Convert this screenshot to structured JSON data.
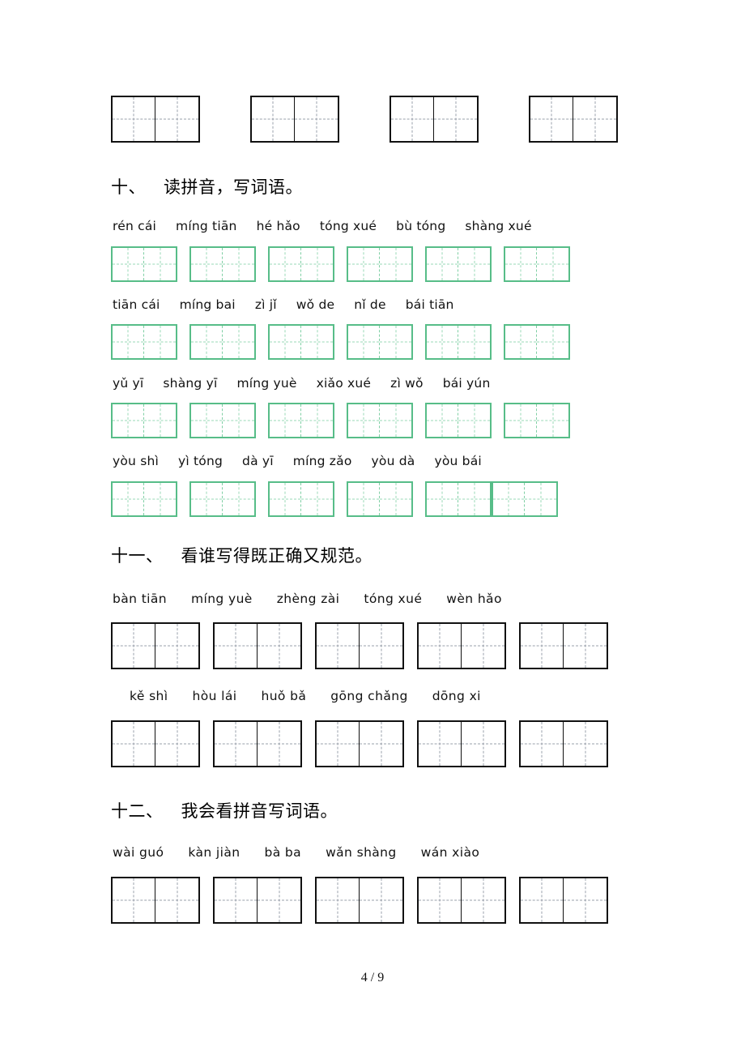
{
  "page": {
    "footer": "4 / 9",
    "colors": {
      "black_grid": "#111111",
      "green_grid": "#57bd88",
      "guide_dash": "#9aa0ab",
      "background": "#ffffff"
    }
  },
  "top_grids": {
    "cells_per_box": 2,
    "box_count": 4,
    "style": "black"
  },
  "sections": [
    {
      "id": "section-10",
      "number": "十、",
      "title": "读拼音，写词语。",
      "grid_style": "green",
      "cells_per_box": 2,
      "rows": [
        {
          "pinyin": [
            "rén cái",
            "míng tiān",
            "hé hǎo",
            "tóng xué",
            "bù tóng",
            "shàng xué"
          ],
          "box_count": 6
        },
        {
          "pinyin": [
            "tiān cái",
            "míng bai",
            "zì jǐ",
            "wǒ de",
            "nǐ de",
            "bái tiān"
          ],
          "box_count": 6
        },
        {
          "pinyin": [
            "yǔ yī",
            "shàng yī",
            "míng yuè",
            "xiǎo xué",
            "zì wǒ",
            "bái yún"
          ],
          "box_count": 6
        },
        {
          "pinyin": [
            "yòu shì",
            "yì tóng",
            "dà yī",
            "míng zǎo",
            "yòu dà",
            "yòu bái"
          ],
          "box_count": 6
        }
      ]
    },
    {
      "id": "section-11",
      "number": "十一、",
      "title": "看谁写得既正确又规范。",
      "grid_style": "black",
      "cells_per_box": 2,
      "rows": [
        {
          "pinyin": [
            "bàn  tiān",
            "míng  yuè",
            "zhèng zài",
            "tóng  xué",
            "wèn  hǎo"
          ],
          "box_count": 5
        },
        {
          "pinyin": [
            "kě  shì",
            "hòu  lái",
            "huǒ  bǎ",
            "gōng chǎng",
            "dōng  xi"
          ],
          "box_count": 5
        }
      ]
    },
    {
      "id": "section-12",
      "number": "十二、",
      "title": "我会看拼音写词语。",
      "grid_style": "black",
      "cells_per_box": 2,
      "rows": [
        {
          "pinyin": [
            "wài  guó",
            "kàn  jiàn",
            "bà  ba",
            "wǎn shàng",
            "wán  xiào"
          ],
          "box_count": 5
        }
      ]
    }
  ]
}
